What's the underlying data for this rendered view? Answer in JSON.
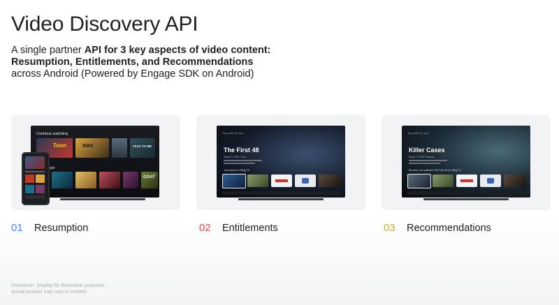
{
  "title": "Video Discovery API",
  "subtitle": {
    "line1_pre": "A single partner ",
    "line1_bold": "API for 3 key aspects of video content:",
    "line2_bold": "Resumption, Entitlements, and Recommendations",
    "line3": "across Android (Powered by Engage SDK on Android)"
  },
  "cards": [
    {
      "number": "01",
      "label": "Resumption",
      "number_color": "#4285f4",
      "screen": {
        "row1_label": "Continue watching",
        "tile_text": [
          "Toon",
          "BBN",
          "TALK TO ME"
        ],
        "row2_label": "Just Google",
        "tile_text2": "GOAT"
      }
    },
    {
      "number": "02",
      "label": "Entitlements",
      "number_color": "#ea4335",
      "screen": {
        "top_label": "Top picks for you",
        "hero_title": "The First 48",
        "meta": "Sling TV   2023   1 Hrs",
        "row_label": "Just added on Sling TV"
      }
    },
    {
      "number": "03",
      "label": "Recommendations",
      "number_color": "#c9b21b",
      "screen": {
        "top_label": "Top picks for you",
        "hero_title": "Killer Cases",
        "meta": "Sling TV   2023   Popular",
        "row_label": "Because you watched The First 48 on Sling TV"
      }
    }
  ],
  "disclaimer": {
    "line1": "Disclaimer: Display for illustrative purposes.",
    "line2": "Actual product may vary in content."
  }
}
